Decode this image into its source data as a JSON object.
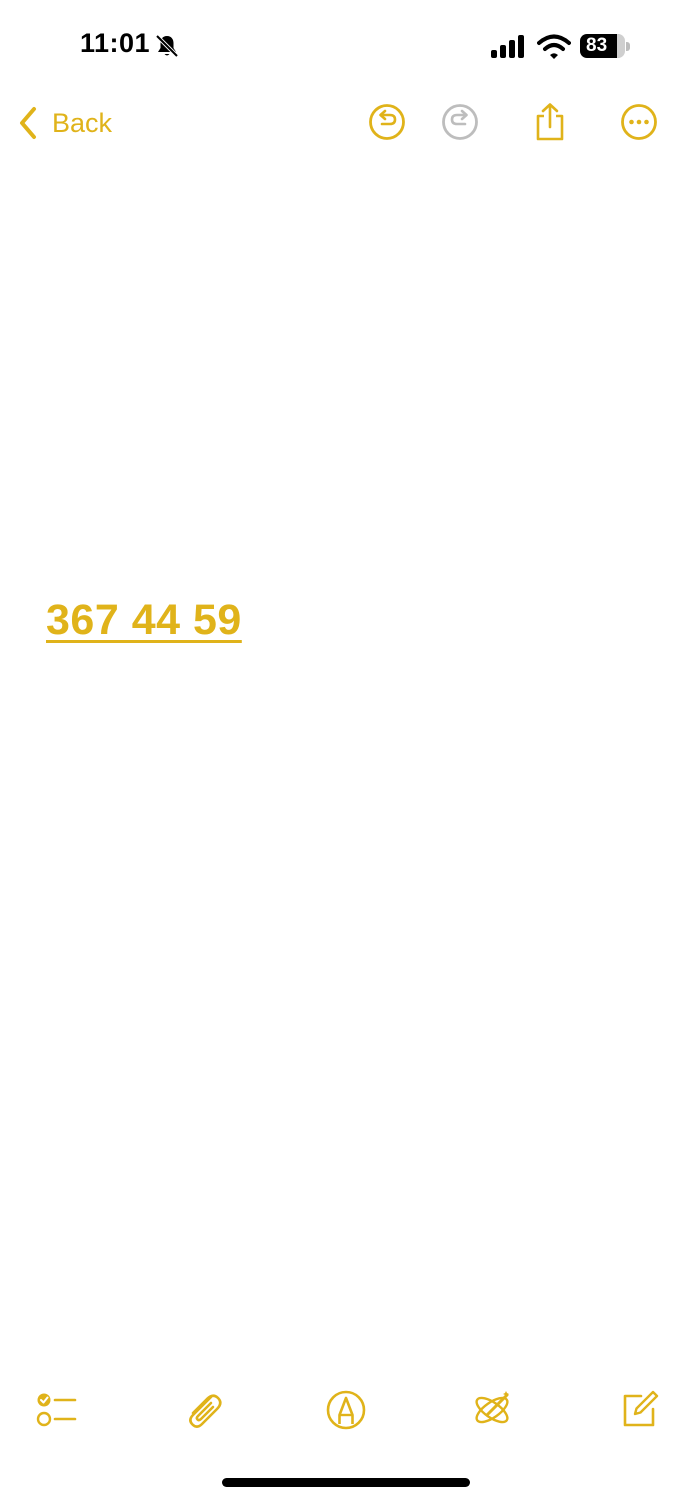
{
  "status_bar": {
    "time": "11:01",
    "battery_level": "83",
    "icons": [
      "bell-slash-icon",
      "signal-icon",
      "wifi-icon",
      "battery-icon"
    ]
  },
  "nav": {
    "back_label": "Back",
    "icons": [
      "undo-icon",
      "redo-icon",
      "share-icon",
      "more-icon"
    ]
  },
  "note": {
    "content": "367 44 59"
  },
  "toolbar": {
    "icons": [
      "checklist-icon",
      "paperclip-icon",
      "markup-icon",
      "writing-tools-icon",
      "compose-icon"
    ]
  },
  "colors": {
    "accent": "#E0B31A",
    "disabled": "#BDBDBD",
    "background": "#FFFFFF"
  }
}
